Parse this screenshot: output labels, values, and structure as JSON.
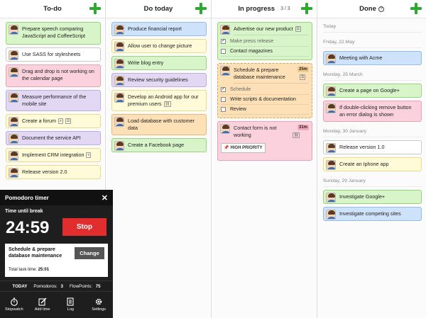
{
  "columns": [
    {
      "title": "To-do",
      "count": "",
      "cards": [
        {
          "text": "Prepare speech comparing JavaScript and CoffeeScript",
          "color": "green"
        },
        {
          "text": "Use SASS for stylesheets",
          "color": "white"
        },
        {
          "text": "Drag and drop is not working on the calendar page",
          "color": "pink"
        },
        {
          "text": "Measure performance of the mobile site",
          "color": "purple"
        },
        {
          "text": "Create a forum",
          "color": "yellow"
        },
        {
          "text": "Document the service API",
          "color": "purple"
        },
        {
          "text": "Implement CRM integration",
          "color": "yellow"
        },
        {
          "text": "Release version 2.0",
          "color": "yellow"
        }
      ]
    },
    {
      "title": "Do today",
      "count": "",
      "cards": [
        {
          "text": "Produce financial report",
          "color": "blue"
        },
        {
          "text": "Allow user to change picture",
          "color": "yellow"
        },
        {
          "text": "Write blog entry",
          "color": "green"
        },
        {
          "text": "Review security guidelines",
          "color": "purple"
        },
        {
          "text": "Develop an Android app for our premium users",
          "color": "yellow"
        },
        {
          "text": "Load database with customer data",
          "color": "orange"
        },
        {
          "text": "Create a Facebook page",
          "color": "green"
        }
      ]
    },
    {
      "title": "In progress",
      "count": "3 / 3",
      "cards": [
        {
          "text": "Advertise our new product",
          "color": "green",
          "subtasks": [
            "Make press release",
            "Contact magazines"
          ]
        },
        {
          "text": "Schedule & prepare database maintenance",
          "color": "orange",
          "time": "25m",
          "subtasks": [
            "Schedule",
            "Write scripts & documentation",
            "Review"
          ]
        },
        {
          "text": "Contact form is not working",
          "color": "pink",
          "time": "31m",
          "priority": "HIGH PRIORITY"
        }
      ]
    },
    {
      "title": "Done",
      "count": "",
      "groups": [
        {
          "date": "Today",
          "cards": []
        },
        {
          "date": "Friday, 22 May",
          "cards": [
            {
              "text": "Meeting with Acme",
              "color": "blue"
            }
          ]
        },
        {
          "date": "Monday, 25 March",
          "cards": [
            {
              "text": "Create a page on Google+",
              "color": "green"
            },
            {
              "text": "If double-clicking remove button an error dialog is shown",
              "color": "pink"
            }
          ]
        },
        {
          "date": "Monday, 30 January",
          "cards": [
            {
              "text": "Release version 1.0",
              "color": "white"
            },
            {
              "text": "Create an Iphone app",
              "color": "yellow"
            }
          ]
        },
        {
          "date": "Sunday, 29 January",
          "cards": [
            {
              "text": "Investigate Google+",
              "color": "green"
            },
            {
              "text": "Investigate competing sites",
              "color": "blue"
            }
          ]
        }
      ]
    }
  ],
  "pomodoro": {
    "title": "Pomodoro timer",
    "label": "Time until break",
    "timer": "24:59",
    "stop_label": "Stop",
    "task_name": "Schedule & prepare database maintenance",
    "change_label": "Change",
    "total_label": "Total task time:",
    "total_value": "25:01",
    "today_label": "TODAY",
    "pomodoros_label": "Pomodoros:",
    "pomodoros_value": "3",
    "flowpoints_label": "FlowPoints:",
    "flowpoints_value": "75",
    "tools": [
      "Stopwatch",
      "Add time",
      "Log",
      "Settings"
    ]
  },
  "colors": {
    "accent_green": "#2fa82f",
    "stop_red": "#e12d2d",
    "panel_dark": "#1e1e1e"
  }
}
